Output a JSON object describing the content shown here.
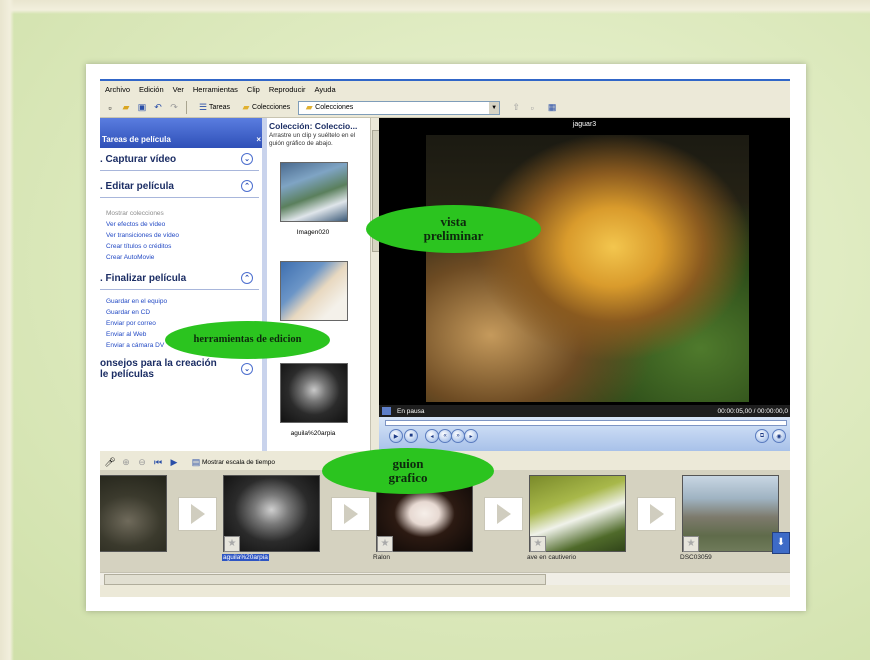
{
  "menu": [
    "Archivo",
    "Edición",
    "Ver",
    "Herramientas",
    "Clip",
    "Reproducir",
    "Ayuda"
  ],
  "toolbar": {
    "tasks_label": "Tareas",
    "collections_label": "Colecciones",
    "combo_value": "Colecciones"
  },
  "tasks_panel": {
    "title": "Tareas de película",
    "close": "×",
    "sections": [
      {
        "title": ". Capturar vídeo",
        "toggle": "⌄",
        "links": []
      },
      {
        "title": ". Editar película",
        "toggle": "⌃",
        "links": [
          "Mostrar colecciones",
          "Ver efectos de vídeo",
          "Ver transiciones de vídeo",
          "Crear títulos o créditos",
          "Crear AutoMovie"
        ]
      },
      {
        "title": ". Finalizar película",
        "toggle": "⌃",
        "links": [
          "Guardar en el equipo",
          "Guardar en CD",
          "Enviar por correo",
          "Enviar al Web",
          "Enviar a cámara DV"
        ]
      },
      {
        "title": "onsejos para la creación\nle películas",
        "toggle": "⌄",
        "links": []
      }
    ]
  },
  "collection": {
    "title": "Colección: Coleccio...",
    "subtitle": "Arrastre un clip y suéltelo en el guión gráfico de abajo.",
    "items": [
      "Imagen020",
      "",
      "aguila%20arpia"
    ]
  },
  "monitor": {
    "title": "jaguar3",
    "status": "En pausa",
    "time": "00:00:05,00 / 00:00:00,0"
  },
  "storyboard_toolbar": {
    "label": "Mostrar escala de tiempo"
  },
  "storyboard": {
    "captions": [
      "",
      "aguila%20arpia",
      "Ralon",
      "ave en cautiverio",
      "DSC03059"
    ]
  },
  "callouts": {
    "preview": "vista\npreliminar",
    "tools": "herramientas de edicion",
    "storyboard": "guion\ngrafico"
  },
  "colors": {
    "callout": "#2bc41f",
    "task_header": "#2f50b8",
    "link": "#2249c4"
  }
}
